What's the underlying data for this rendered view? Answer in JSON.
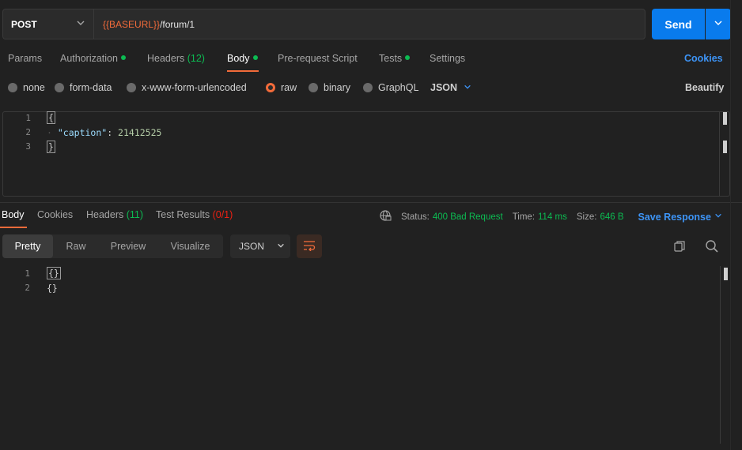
{
  "request": {
    "method": "POST",
    "url_variable": "{{BASEURL}}",
    "url_path": "/forum/1",
    "send_label": "Send"
  },
  "request_tabs": {
    "params": "Params",
    "authorization": "Authorization",
    "headers": "Headers",
    "headers_count": "(12)",
    "body": "Body",
    "prerequest": "Pre-request Script",
    "tests": "Tests",
    "settings": "Settings",
    "cookies": "Cookies"
  },
  "body_types": {
    "none": "none",
    "form_data": "form-data",
    "urlencoded": "x-www-form-urlencoded",
    "raw": "raw",
    "binary": "binary",
    "graphql": "GraphQL",
    "language": "JSON",
    "beautify": "Beautify"
  },
  "request_body": {
    "line_numbers": [
      "1",
      "2",
      "3"
    ],
    "open_brace": "{",
    "key": "\"caption\"",
    "colon": ": ",
    "value": "21412525",
    "close_brace": "}"
  },
  "response_tabs": {
    "body": "Body",
    "cookies": "Cookies",
    "headers": "Headers",
    "headers_count": "(11)",
    "test_results": "Test Results",
    "test_results_count": "(0/1)"
  },
  "response_status": {
    "status_label": "Status:",
    "status_value": "400 Bad Request",
    "time_label": "Time:",
    "time_value": "114 ms",
    "size_label": "Size:",
    "size_value": "646 B",
    "save_response": "Save Response"
  },
  "response_view": {
    "pretty": "Pretty",
    "raw": "Raw",
    "preview": "Preview",
    "visualize": "Visualize",
    "format": "JSON"
  },
  "response_body": {
    "line_numbers": [
      "1",
      "2"
    ],
    "line1": "{}",
    "line2": "{}"
  },
  "colors": {
    "accent": "#f26b3a",
    "send_blue": "#097bed",
    "link_blue": "#3d94f6",
    "status_green": "#0cbb52",
    "error_red": "#eb2013",
    "background": "#212121"
  },
  "icons": [
    "chevron-down-icon",
    "globe-icon",
    "wrap-lines-icon",
    "copy-icon",
    "search-icon"
  ]
}
